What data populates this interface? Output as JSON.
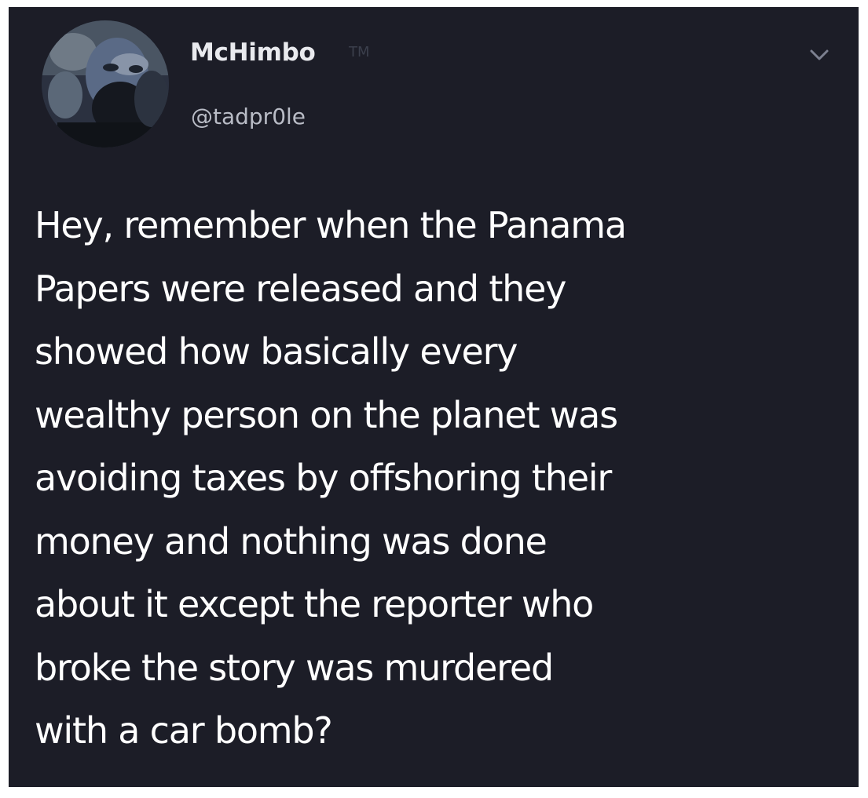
{
  "tweet": {
    "author": {
      "display_name": "McHimbo",
      "badge": "TM",
      "handle": "@tadpr0le",
      "avatar_icon": "user-avatar"
    },
    "menu_icon": "chevron-down-icon",
    "lines": [
      "Hey, remember when the Panama",
      "Papers were released and they",
      "showed how basically every",
      "wealthy person on the planet was",
      "avoiding taxes by offshoring their",
      "money and nothing was done",
      "about it except the reporter who",
      "broke the story was murdered",
      "with a car bomb?"
    ]
  },
  "colors": {
    "background": "#1c1d27",
    "text": "#ffffff",
    "secondary_text": "#b9bcc6"
  }
}
